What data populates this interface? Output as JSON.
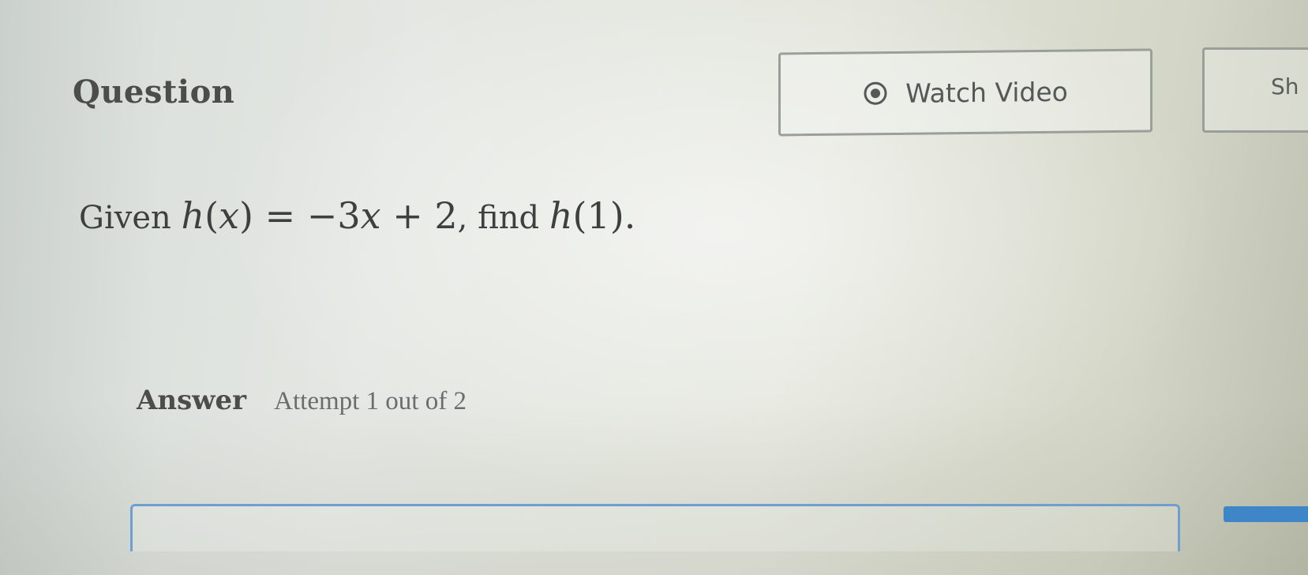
{
  "question": {
    "heading": "Question",
    "prompt_given": "Given",
    "function_name": "h",
    "variable": "x",
    "equals": "=",
    "minus": "−",
    "coefficient": "3",
    "plus": "+",
    "constant": "2",
    "find_text": ", find",
    "evaluate_at": "1",
    "end_period": "."
  },
  "toolbar": {
    "watch_video_label": "Watch Video",
    "show_label": "Sh"
  },
  "answer": {
    "label": "Answer",
    "attempt_text": "Attempt 1 out of 2",
    "input_value": ""
  },
  "colors": {
    "accent": "#3f86c8",
    "input_border": "#6f9fcf"
  },
  "icons": {
    "play": "play-circle-icon"
  }
}
